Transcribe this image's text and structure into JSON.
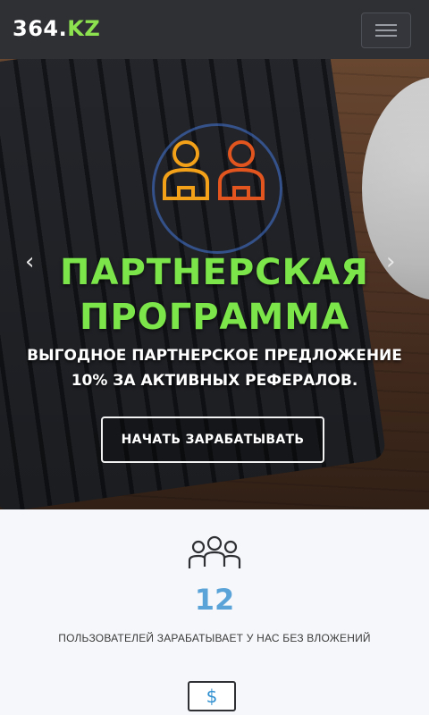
{
  "header": {
    "logo_main": "364.",
    "logo_accent": "KZ",
    "menu_icon": "hamburger-menu-icon"
  },
  "hero": {
    "title_line1": "ПАРТНЕРСКАЯ",
    "title_line2": "ПРОГРАММА",
    "subtitle_line1": "ВЫГОДНОЕ ПАРТНЕРСКОЕ ПРЕДЛОЖЕНИЕ",
    "subtitle_line2": "10% ЗА АКТИВНЫХ РЕФЕРАЛОВ.",
    "cta_label": "НАЧАТЬ ЗАРАБАТЫВАТЬ",
    "prev_arrow": "‹",
    "next_arrow": "›",
    "icon": "partners-icon"
  },
  "stats": {
    "icon": "users-icon",
    "count": "12",
    "description": "ПОЛЬЗОВАТЕЛЕЙ ЗАРАБАТЫВАЕТ У НАС БЕЗ ВЛОЖЕНИЙ",
    "money_icon_glyph": "$"
  },
  "colors": {
    "navbar": "#2f3034",
    "accent_green": "#7be54a",
    "count_blue": "#5aa3d8"
  }
}
